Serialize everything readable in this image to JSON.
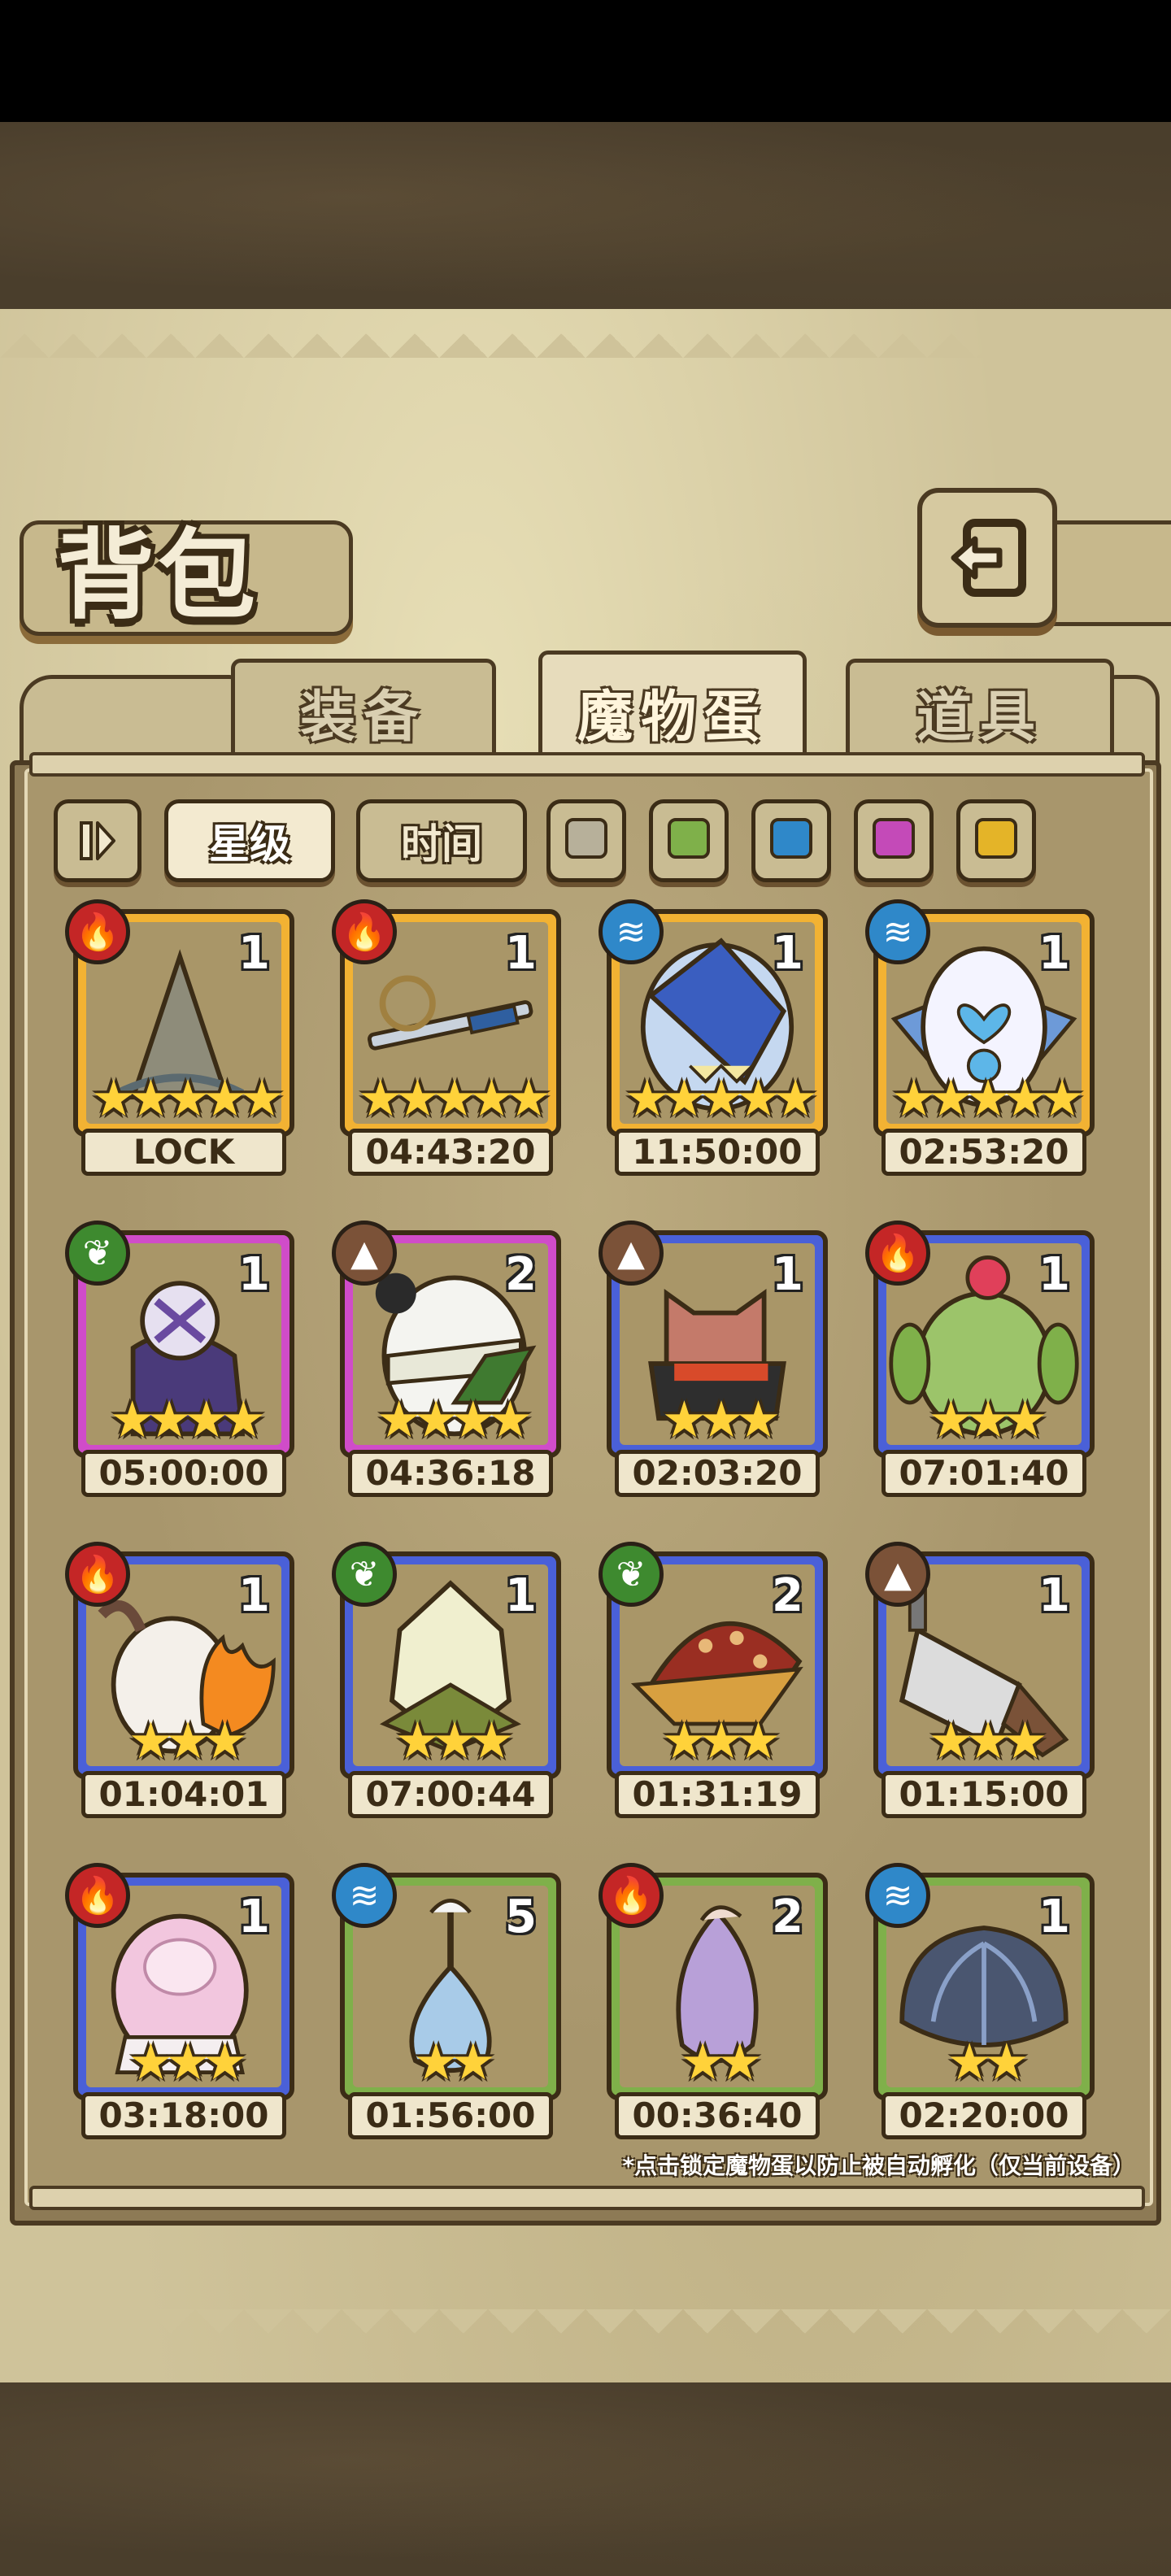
{
  "title": "背包",
  "tabs": [
    {
      "label": "装备",
      "active": false
    },
    {
      "label": "魔物蛋",
      "active": true
    },
    {
      "label": "道具",
      "active": false
    }
  ],
  "filters": {
    "sort_star": "星级",
    "sort_time": "时间",
    "colors": [
      "#b7b09a",
      "#7fb04a",
      "#2f88c9",
      "#c44ab8",
      "#e4b428"
    ]
  },
  "eggs": [
    {
      "element": "fire",
      "count": "1",
      "stars": "★★★★★",
      "timer": "LOCK",
      "rarity": 5,
      "icon": "hat-egg-icon"
    },
    {
      "element": "fire",
      "count": "1",
      "stars": "★★★★★",
      "timer": "04:43:20",
      "rarity": 5,
      "icon": "sword-egg-icon"
    },
    {
      "element": "water",
      "count": "1",
      "stars": "★★★★★",
      "timer": "11:50:00",
      "rarity": 5,
      "icon": "shark-egg-icon"
    },
    {
      "element": "water",
      "count": "1",
      "stars": "★★★★★",
      "timer": "02:53:20",
      "rarity": 5,
      "icon": "heart-egg-icon"
    },
    {
      "element": "leaf",
      "count": "1",
      "stars": "★★★★",
      "timer": "05:00:00",
      "rarity": 4,
      "icon": "scythe-egg-icon"
    },
    {
      "element": "earth",
      "count": "2",
      "stars": "★★★★",
      "timer": "04:36:18",
      "rarity": 4,
      "icon": "panda-egg-icon"
    },
    {
      "element": "earth",
      "count": "1",
      "stars": "★★★",
      "timer": "02:03:20",
      "rarity": 3,
      "icon": "cat-egg-icon"
    },
    {
      "element": "fire",
      "count": "1",
      "stars": "★★★",
      "timer": "07:01:40",
      "rarity": 3,
      "icon": "cactus-egg-icon"
    },
    {
      "element": "fire",
      "count": "1",
      "stars": "★★★",
      "timer": "01:04:01",
      "rarity": 3,
      "icon": "flame-egg-icon"
    },
    {
      "element": "leaf",
      "count": "1",
      "stars": "★★★",
      "timer": "07:00:44",
      "rarity": 3,
      "icon": "lotus-egg-icon"
    },
    {
      "element": "leaf",
      "count": "2",
      "stars": "★★★",
      "timer": "01:31:19",
      "rarity": 3,
      "icon": "mushroom-egg-icon"
    },
    {
      "element": "earth",
      "count": "1",
      "stars": "★★★",
      "timer": "01:15:00",
      "rarity": 3,
      "icon": "cleaver-egg-icon"
    },
    {
      "element": "fire",
      "count": "1",
      "stars": "★★★",
      "timer": "03:18:00",
      "rarity": 3,
      "icon": "pink-egg-icon"
    },
    {
      "element": "water",
      "count": "5",
      "stars": "★★",
      "timer": "01:56:00",
      "rarity": 2,
      "icon": "drop-egg-icon"
    },
    {
      "element": "fire",
      "count": "2",
      "stars": "★★",
      "timer": "00:36:40",
      "rarity": 2,
      "icon": "bud-egg-icon"
    },
    {
      "element": "water",
      "count": "1",
      "stars": "★★",
      "timer": "02:20:00",
      "rarity": 2,
      "icon": "shell-egg-icon"
    }
  ],
  "note": "*点击锁定魔物蛋以防止被自动孵化（仅当前设备）"
}
